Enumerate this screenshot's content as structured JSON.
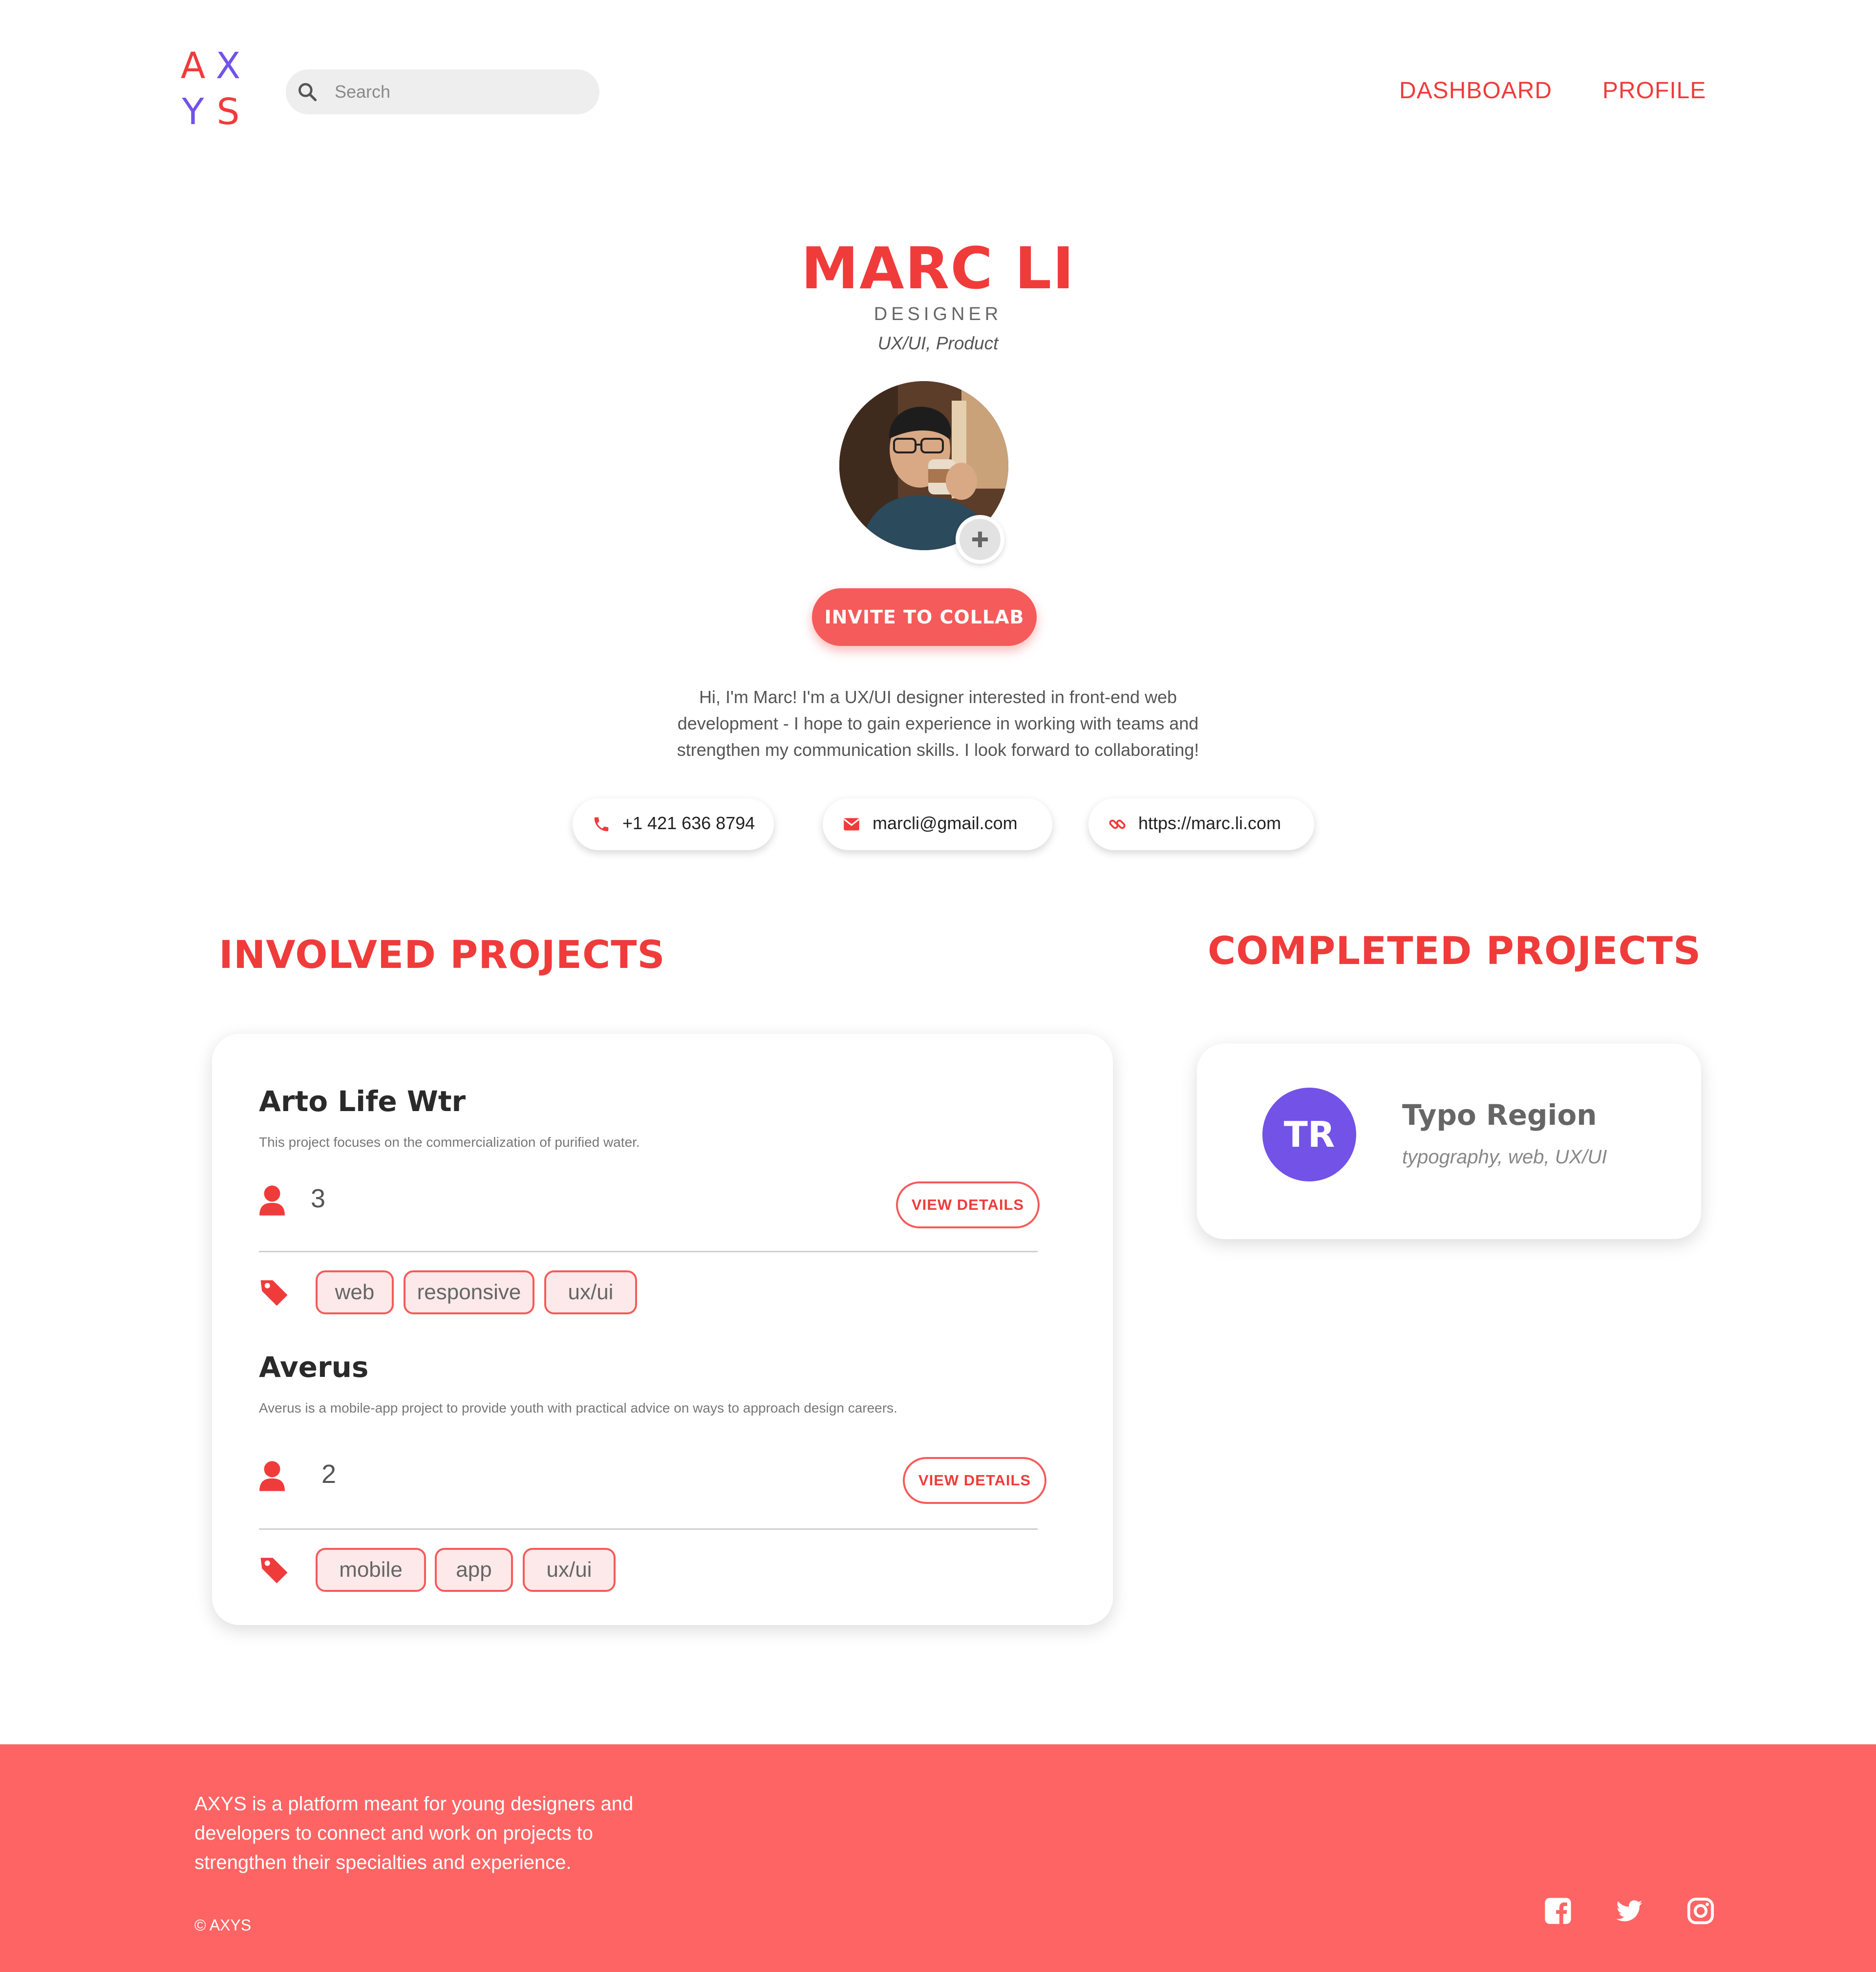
{
  "brand": {
    "logo_letters": [
      "A",
      "X",
      "Y",
      "S"
    ],
    "logo_colors": [
      "#f03b3b",
      "#7352e8",
      "#7352e8",
      "#f03b3b"
    ],
    "accent": "#f03b3b",
    "accent_soft": "#ff6464",
    "purple": "#7352e8"
  },
  "header": {
    "search_placeholder": "Search",
    "search_icon": "search-icon",
    "nav": [
      {
        "label": "DASHBOARD"
      },
      {
        "label": "PROFILE"
      }
    ]
  },
  "profile": {
    "name": "MARC LI",
    "role": "DESIGNER",
    "specialties": "UX/UI, Product",
    "invite_label": "INVITE TO COLLAB",
    "bio": "Hi, I'm Marc! I'm a UX/UI designer interested in front-end web development - I hope to gain experience in working with teams and strengthen my communication skills. I look forward to collaborating!",
    "contacts": [
      {
        "icon": "phone-icon",
        "value": "+1 421 636 8794"
      },
      {
        "icon": "envelope-icon",
        "value": "marcli@gmail.com"
      },
      {
        "icon": "link-icon",
        "value": "https://marc.li.com"
      }
    ]
  },
  "involved": {
    "title": "INVOLVED PROJECTS",
    "projects": [
      {
        "name": "Arto Life Wtr",
        "description": "This project focuses on the commercialization of purified water.",
        "members": "3",
        "button_label": "VIEW DETAILS",
        "tags": [
          "web",
          "responsive",
          "ux/ui"
        ]
      },
      {
        "name": "Averus",
        "description": "Averus is a mobile-app project to provide youth with practical advice on ways to approach design careers.",
        "members": "2",
        "button_label": "VIEW DETAILS",
        "tags": [
          "mobile",
          "app",
          "ux/ui"
        ]
      }
    ]
  },
  "completed": {
    "title": "COMPLETED PROJECTS",
    "projects": [
      {
        "initials": "TR",
        "name": "Typo Region",
        "tags": "typography, web, UX/UI"
      }
    ]
  },
  "footer": {
    "about": "AXYS is a platform meant for young designers and developers to connect and work on projects to strengthen their specialties and experience.",
    "copyright": "© AXYS",
    "social_icons": [
      "facebook-icon",
      "twitter-icon",
      "instagram-icon"
    ]
  }
}
